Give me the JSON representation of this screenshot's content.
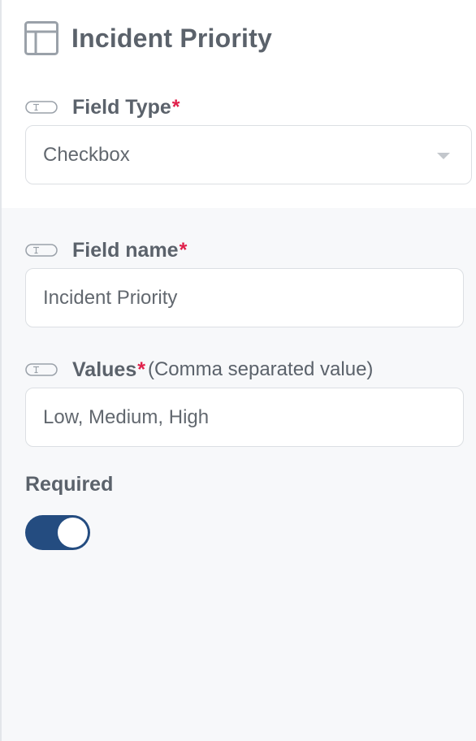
{
  "panel": {
    "title": "Incident Priority",
    "icon": "layout-icon"
  },
  "field_type": {
    "label": "Field Type",
    "required_marker": "*",
    "selected_value": "Checkbox",
    "icon": "text-field-icon"
  },
  "field_name": {
    "label": "Field name",
    "required_marker": "*",
    "value": "Incident Priority",
    "icon": "text-field-icon"
  },
  "values": {
    "label": "Values",
    "required_marker": "*",
    "hint": "(Comma separated value)",
    "value": "Low, Medium, High",
    "icon": "text-field-icon"
  },
  "required_toggle": {
    "label": "Required",
    "on": true
  },
  "colors": {
    "accent": "#244c80",
    "required_star": "#e0204a",
    "text": "#5b626b",
    "section_background": "#f7f8fa"
  }
}
